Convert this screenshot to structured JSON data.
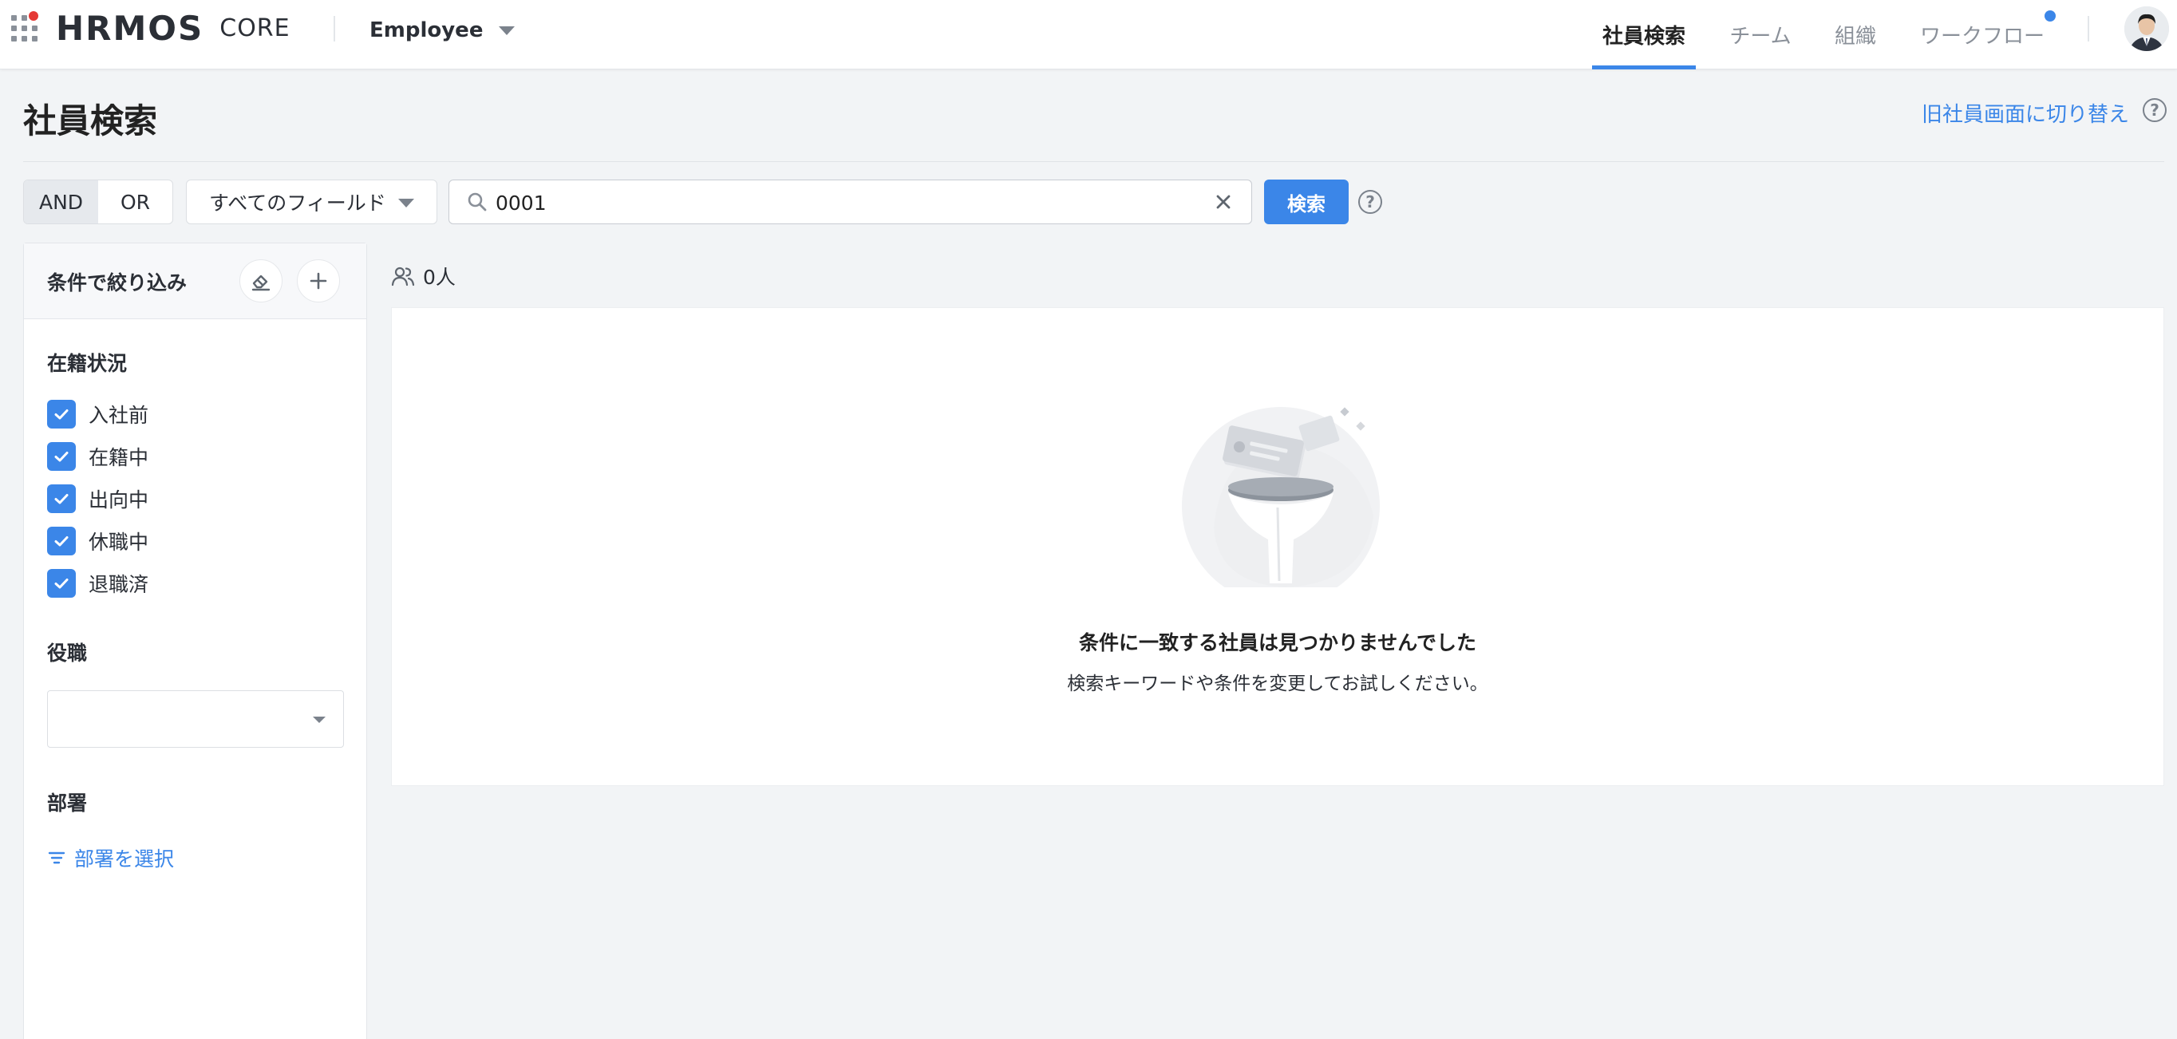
{
  "header": {
    "logo_text": "HRMOS",
    "logo_sub": "CORE",
    "app_switcher": "Employee",
    "nav": [
      {
        "label": "社員検索",
        "active": true
      },
      {
        "label": "チーム",
        "active": false
      },
      {
        "label": "組織",
        "active": false
      },
      {
        "label": "ワークフロー",
        "active": false,
        "has_badge": true
      }
    ],
    "accent_color": "#3b86e8"
  },
  "page": {
    "title": "社員検索",
    "legacy_link": "旧社員画面に切り替え",
    "help_glyph": "?"
  },
  "search": {
    "mode_and": "AND",
    "mode_or": "OR",
    "mode_selected": "AND",
    "field_select": "すべてのフィールド",
    "query_value": "0001",
    "button_label": "検索",
    "help_glyph": "?"
  },
  "filters": {
    "title": "条件で絞り込み",
    "status_title": "在籍状況",
    "statuses": [
      {
        "label": "入社前",
        "checked": true
      },
      {
        "label": "在籍中",
        "checked": true
      },
      {
        "label": "出向中",
        "checked": true
      },
      {
        "label": "休職中",
        "checked": true
      },
      {
        "label": "退職済",
        "checked": true
      }
    ],
    "role_title": "役職",
    "role_value": "",
    "dept_title": "部署",
    "dept_link": "部署を選択"
  },
  "results": {
    "count_label": "0人",
    "empty_title": "条件に一致する社員は見つかりませんでした",
    "empty_subtitle": "検索キーワードや条件を変更してお試しください。"
  }
}
